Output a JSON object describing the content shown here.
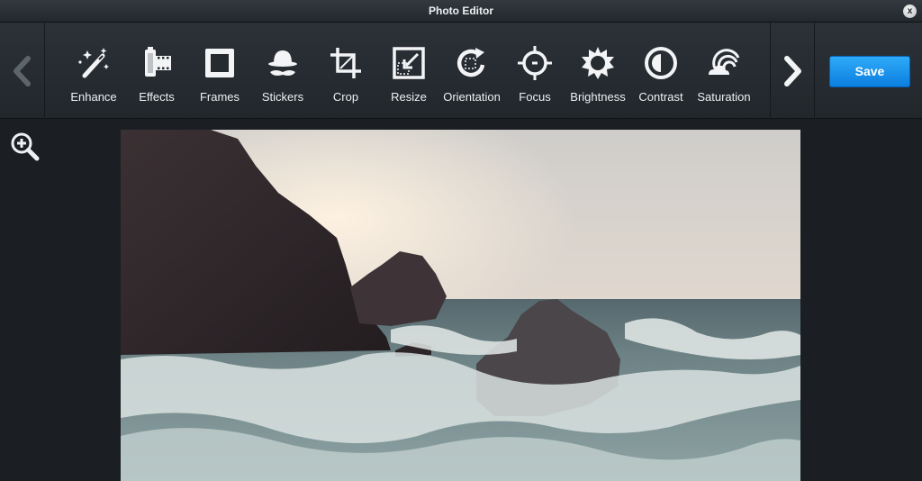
{
  "window": {
    "title": "Photo Editor",
    "close_label": "x"
  },
  "toolbar": {
    "tools": [
      {
        "label": "Enhance",
        "icon": "magic-wand-icon"
      },
      {
        "label": "Effects",
        "icon": "film-roll-icon"
      },
      {
        "label": "Frames",
        "icon": "frame-icon"
      },
      {
        "label": "Stickers",
        "icon": "hat-mustache-icon"
      },
      {
        "label": "Crop",
        "icon": "crop-icon"
      },
      {
        "label": "Resize",
        "icon": "resize-icon"
      },
      {
        "label": "Orientation",
        "icon": "rotate-icon"
      },
      {
        "label": "Focus",
        "icon": "focus-target-icon"
      },
      {
        "label": "Brightness",
        "icon": "sun-icon"
      },
      {
        "label": "Contrast",
        "icon": "contrast-icon"
      },
      {
        "label": "Saturation",
        "icon": "rainbow-icon"
      }
    ],
    "prev_icon": "chevron-left-icon",
    "next_icon": "chevron-right-icon",
    "save_label": "Save"
  },
  "workspace": {
    "zoom_icon": "zoom-in-icon"
  },
  "colors": {
    "accent": "#1a90f0",
    "toolbar_bg": "#262b30",
    "workspace_bg": "#1b1f23",
    "disabled_nav": "#5d656c"
  }
}
